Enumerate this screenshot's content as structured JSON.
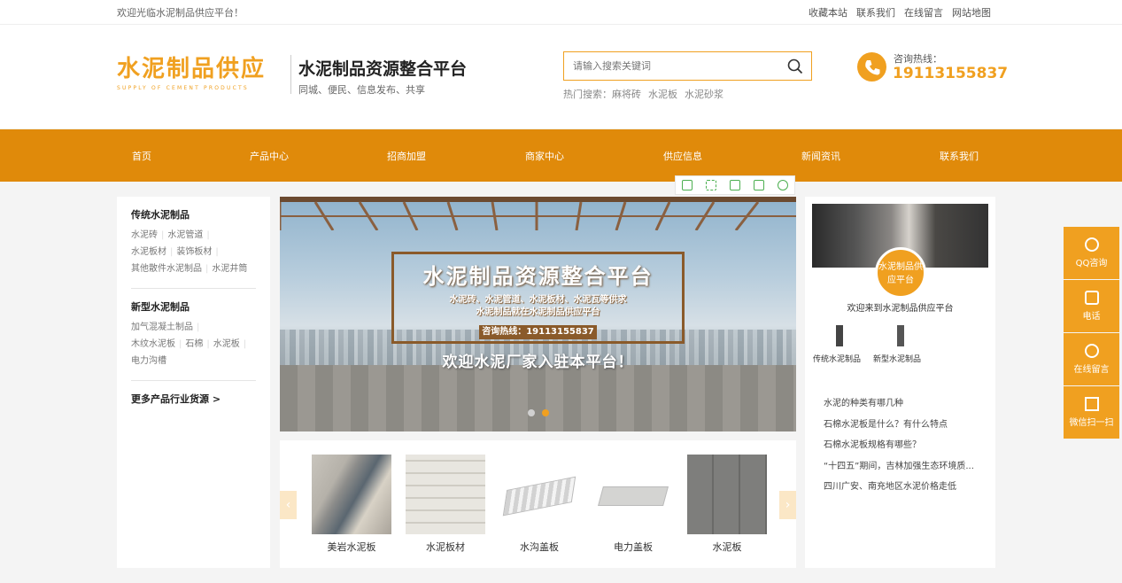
{
  "topbar": {
    "welcome": "欢迎光临水泥制品供应平台！",
    "links": [
      "收藏本站",
      "联系我们",
      "在线留言",
      "网站地图"
    ]
  },
  "header": {
    "logo_cn": "水泥制品供应",
    "logo_en": "SUPPLY OF CEMENT PRODUCTS",
    "slogan_title": "水泥制品资源整合平台",
    "slogan_sub": "同城、便民、信息发布、共享",
    "search_placeholder": "请输入搜索关键词",
    "hot_label": "热门搜索：麻将砖",
    "hot_items": [
      "水泥板",
      "水泥砂浆"
    ],
    "hotline_label": "咨询热线：",
    "hotline_number": "19113155837"
  },
  "nav": {
    "items": [
      "首页",
      "产品中心",
      "招商加盟",
      "商家中心",
      "供应信息",
      "新闻资讯",
      "联系我们"
    ]
  },
  "sidebar": {
    "cats": [
      {
        "title": "传统水泥制品",
        "rows": [
          [
            "水泥砖",
            "水泥管道"
          ],
          [
            "水泥板材",
            "装饰板材"
          ],
          [
            "其他散件水泥制品",
            "水泥井筒"
          ]
        ]
      },
      {
        "title": "新型水泥制品",
        "rows": [
          [
            "加气混凝土制品"
          ],
          [
            "木纹水泥板",
            "石棉",
            "水泥板"
          ],
          [
            "电力沟槽"
          ]
        ]
      }
    ],
    "more": "更多产品行业货源 >"
  },
  "banner": {
    "title": "水泥制品资源整合平台",
    "sub1": "水泥砖、水泥管道、水泥板材、水泥瓦等供求",
    "sub2": "水泥制品就在水泥制品供应平台",
    "hotline": "咨询热线：19113155837",
    "welcome": "欢迎水泥厂家入驻本平台！"
  },
  "products": {
    "items": [
      "美岩水泥板",
      "水泥板材",
      "水沟盖板",
      "电力盖板",
      "水泥板"
    ],
    "prev": "‹",
    "next": "›"
  },
  "right": {
    "badge": "水泥制品供应平台",
    "welcome": "欢迎来到水泥制品供应平台",
    "mini": [
      "传统水泥制品",
      "新型水泥制品"
    ],
    "news": [
      "水泥的种类有哪几种",
      "石棉水泥板是什么？有什么特点",
      "石棉水泥板规格有哪些？",
      "“十四五”期间，吉林加强生态环境质...",
      "四川广安、南充地区水泥价格走低"
    ]
  },
  "float": {
    "items": [
      "QQ咨询",
      "电话",
      "在线留言",
      "微信扫一扫"
    ]
  },
  "colors": {
    "accent": "#f0a020",
    "nav": "#e08a0a"
  }
}
